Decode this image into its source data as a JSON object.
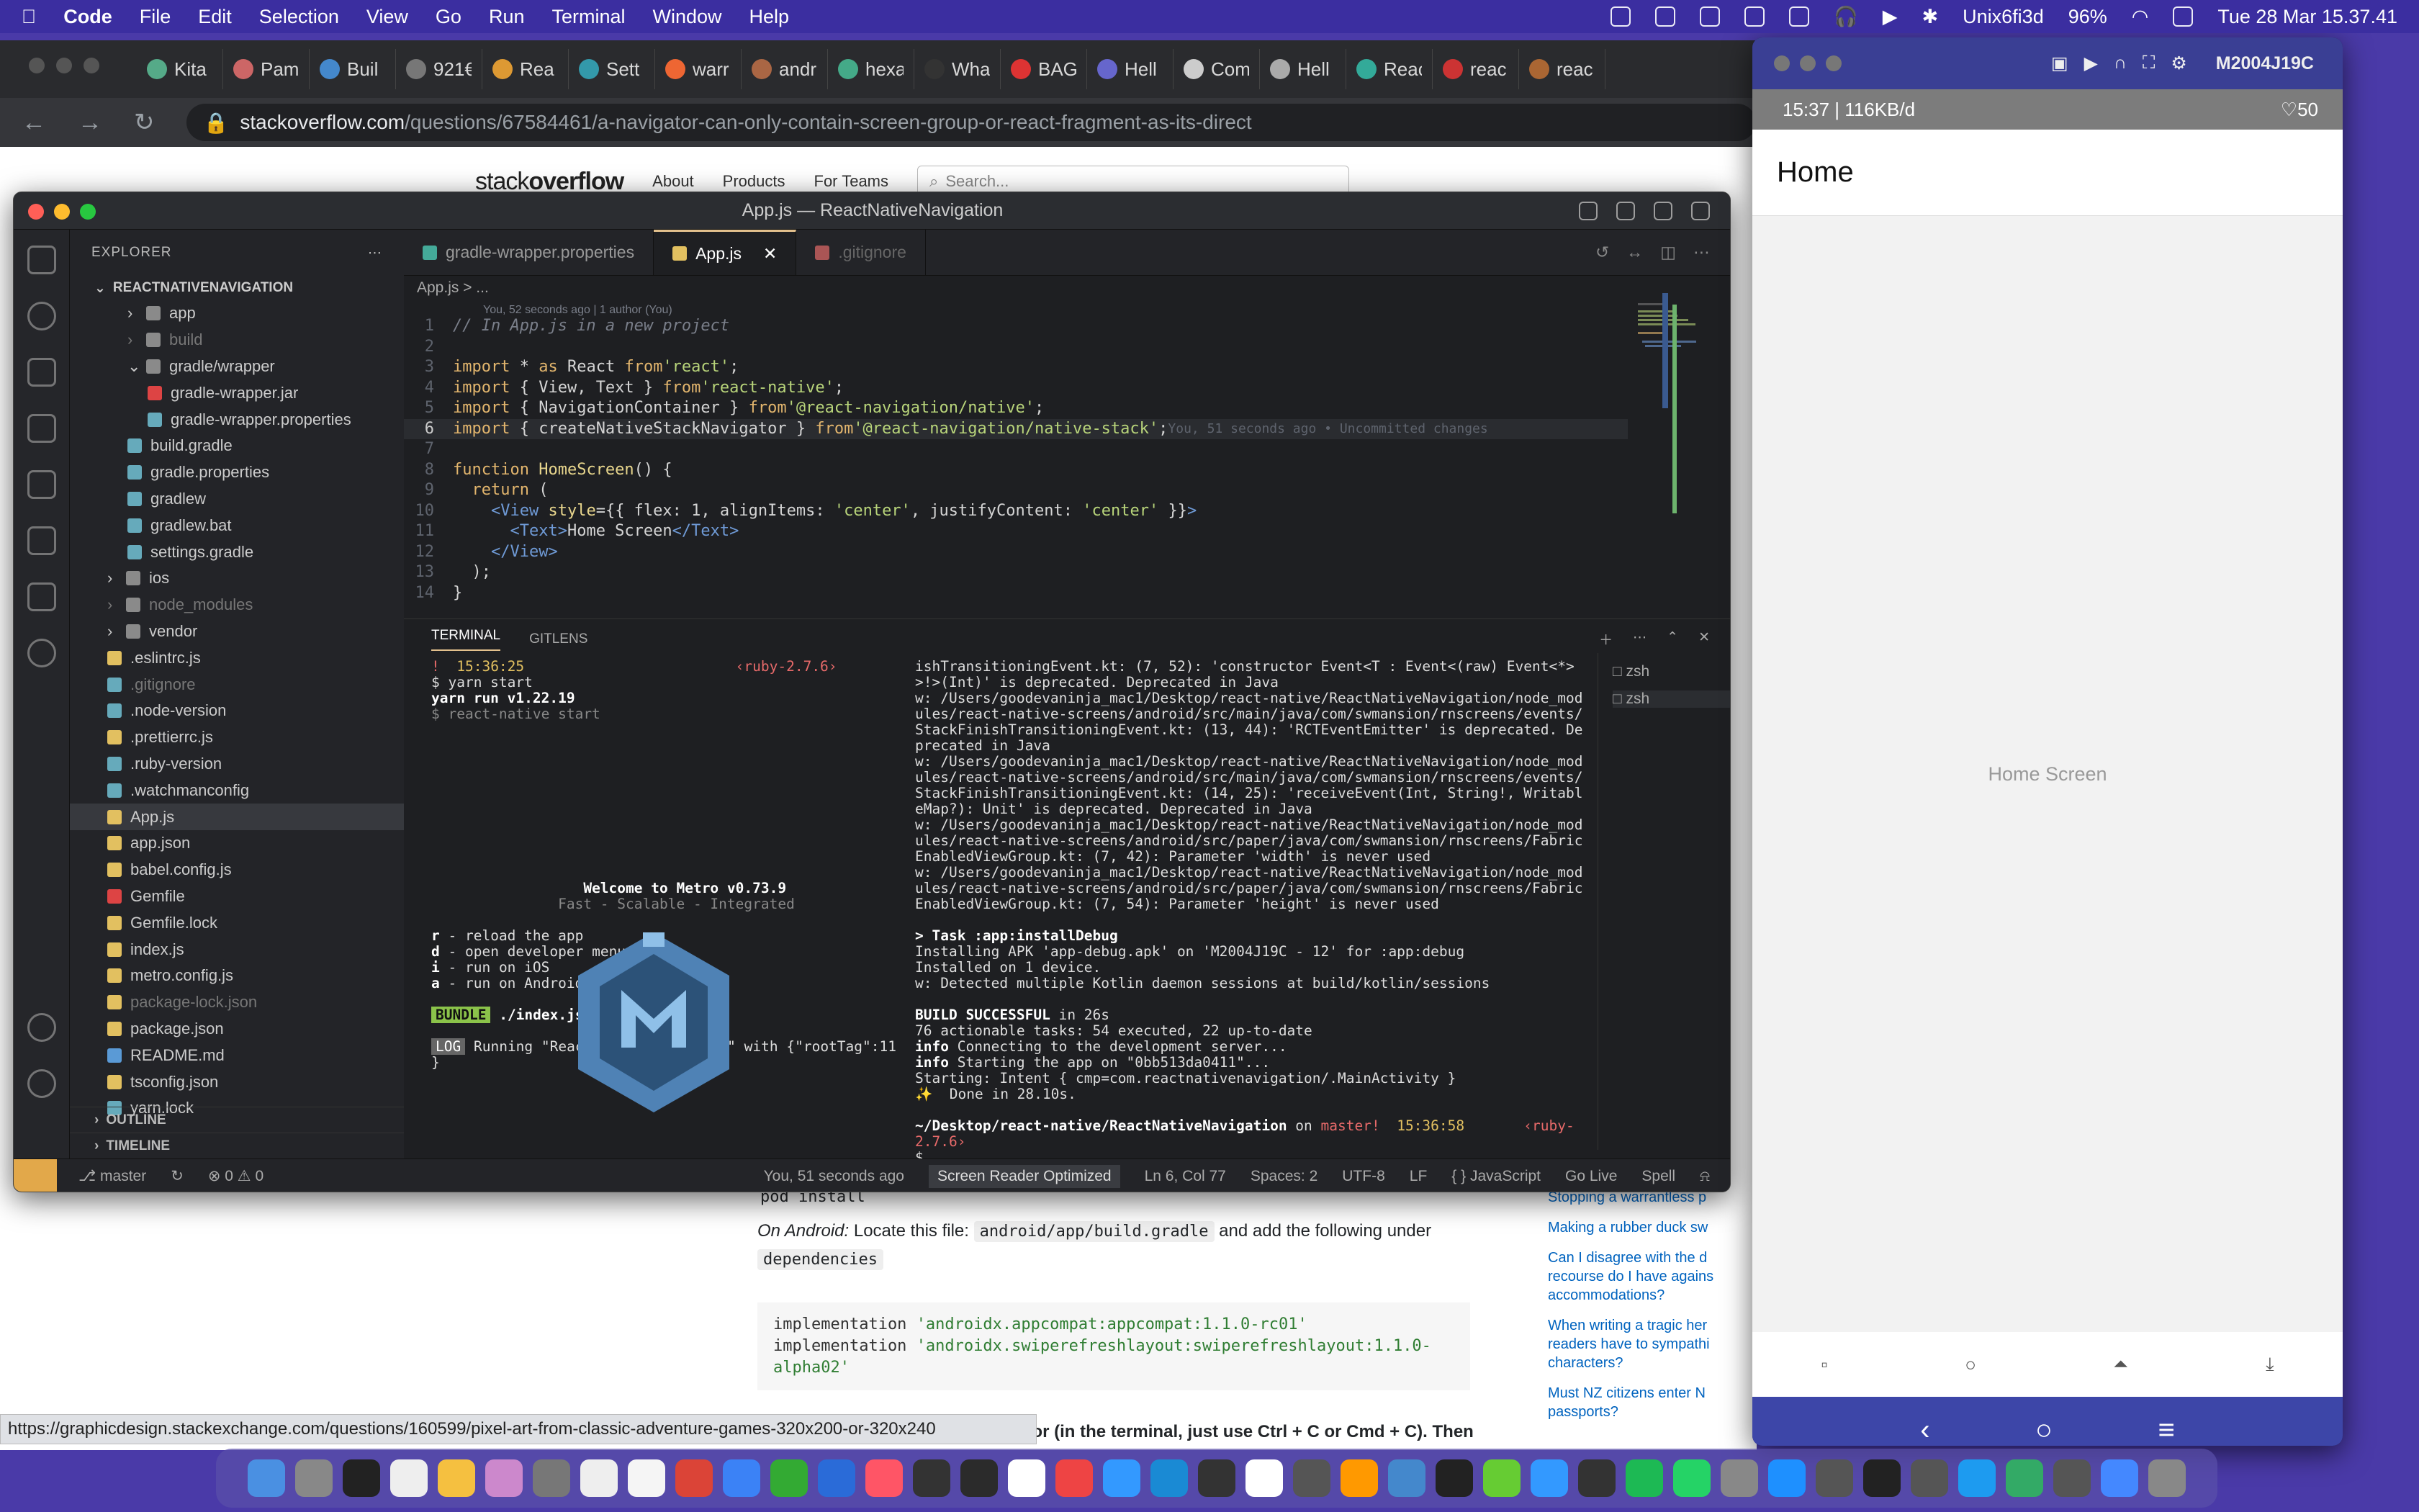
{
  "menubar": {
    "app": "Code",
    "items": [
      "File",
      "Edit",
      "Selection",
      "View",
      "Go",
      "Run",
      "Terminal",
      "Window",
      "Help"
    ],
    "user": "Unix6fi3d",
    "battery": "96%",
    "datetime": "Tue 28 Mar  15.37.41"
  },
  "browser": {
    "tabs": [
      "Kita",
      "Pam",
      "Buil",
      "921€",
      "Rea",
      "Sett",
      "warr",
      "andr",
      "hexa",
      "Wha",
      "BAG",
      "Hell",
      "Com",
      "Hell",
      "Reac",
      "reac",
      "reac"
    ],
    "url_host": "stackoverflow.com",
    "url_path": "/questions/67584461/a-navigator-can-only-contain-screen-group-or-react-fragment-as-its-direct",
    "status_url": "https://graphicdesign.stackexchange.com/questions/160599/pixel-art-from-classic-adventure-games-320x200-or-320x240"
  },
  "so": {
    "logo_a": "stack",
    "logo_b": "overflow",
    "nav": [
      "About",
      "Products",
      "For Teams"
    ],
    "search_placeholder": "Search...",
    "pod": "pod install",
    "android_prefix": "On Android:",
    "android_text": " Locate this file: ",
    "android_file": "android/app/build.gradle",
    "android_text2": " and add the following under ",
    "deps": "dependencies",
    "impl1_a": "implementation ",
    "impl1_b": "'androidx.appcompat:appcompat:1.1.0-rc01'",
    "impl2_a": "implementation ",
    "impl2_b": "'androidx.swiperefreshlayout:swiperefreshlayout:1.1.0-alpha02'",
    "step3": "3. Try to restart Metro and Emulator (in the terminal, just use Ctrl + C or Cmd + C). Then",
    "sidebar": [
      "Stopping a warrantless p",
      "Making a rubber duck sw",
      "Can I disagree with the d recourse do I have agains accommodations?",
      "When writing a tragic her readers have to sympathi characters?",
      "Must NZ citizens enter N passports?"
    ]
  },
  "vscode": {
    "title": "App.js — ReactNativeNavigation",
    "explorer_label": "EXPLORER",
    "project": "REACTNATIVENAVIGATION",
    "tree": [
      {
        "n": "app",
        "d": 1,
        "t": "dir"
      },
      {
        "n": "build",
        "d": 1,
        "t": "dir",
        "dim": true
      },
      {
        "n": "gradle/wrapper",
        "d": 1,
        "t": "open"
      },
      {
        "n": "gradle-wrapper.jar",
        "d": 2,
        "t": "jar"
      },
      {
        "n": "gradle-wrapper.properties",
        "d": 2,
        "t": "file"
      },
      {
        "n": "build.gradle",
        "d": 1,
        "t": "file"
      },
      {
        "n": "gradle.properties",
        "d": 1,
        "t": "file"
      },
      {
        "n": "gradlew",
        "d": 1,
        "t": "file"
      },
      {
        "n": "gradlew.bat",
        "d": 1,
        "t": "file"
      },
      {
        "n": "settings.gradle",
        "d": 1,
        "t": "file"
      },
      {
        "n": "ios",
        "d": 0,
        "t": "dir"
      },
      {
        "n": "node_modules",
        "d": 0,
        "t": "dir",
        "dim": true
      },
      {
        "n": "vendor",
        "d": 0,
        "t": "dir"
      },
      {
        "n": ".eslintrc.js",
        "d": 0,
        "t": "js"
      },
      {
        "n": ".gitignore",
        "d": 0,
        "t": "file",
        "dim": true
      },
      {
        "n": ".node-version",
        "d": 0,
        "t": "file"
      },
      {
        "n": ".prettierrc.js",
        "d": 0,
        "t": "js"
      },
      {
        "n": ".ruby-version",
        "d": 0,
        "t": "file"
      },
      {
        "n": ".watchmanconfig",
        "d": 0,
        "t": "file"
      },
      {
        "n": "App.js",
        "d": 0,
        "t": "js",
        "sel": true
      },
      {
        "n": "app.json",
        "d": 0,
        "t": "json"
      },
      {
        "n": "babel.config.js",
        "d": 0,
        "t": "js"
      },
      {
        "n": "Gemfile",
        "d": 0,
        "t": "gem"
      },
      {
        "n": "Gemfile.lock",
        "d": 0,
        "t": "lock"
      },
      {
        "n": "index.js",
        "d": 0,
        "t": "js"
      },
      {
        "n": "metro.config.js",
        "d": 0,
        "t": "js"
      },
      {
        "n": "package-lock.json",
        "d": 0,
        "t": "json",
        "dim": true
      },
      {
        "n": "package.json",
        "d": 0,
        "t": "json"
      },
      {
        "n": "README.md",
        "d": 0,
        "t": "md"
      },
      {
        "n": "tsconfig.json",
        "d": 0,
        "t": "json"
      },
      {
        "n": "yarn.lock",
        "d": 0,
        "t": "file"
      }
    ],
    "outline": "OUTLINE",
    "timeline": "TIMELINE",
    "tabs": [
      "gradle-wrapper.properties",
      "App.js",
      ".gitignore"
    ],
    "breadcrumb": "App.js > ...",
    "blame": "You, 52 seconds ago | 1 author (You)",
    "inline_blame": "You, 51 seconds ago • Uncommitted changes",
    "terminal_tab": "TERMINAL",
    "gitlens_tab": "GITLENS",
    "metro": {
      "bang": "!",
      "time": "15:36:25",
      "ruby": "‹ruby-2.7.6›",
      "cmd": "$ yarn start",
      "yarn": "yarn run v1.22.19",
      "rn": "$ react-native start",
      "welcome": "Welcome to Metro",
      "ver": "v0.73.9",
      "tag": "Fast - Scalable - Integrated",
      "keys": [
        [
          "r",
          "reload the app"
        ],
        [
          "d",
          "open developer menu"
        ],
        [
          "i",
          "run on iOS"
        ],
        [
          "a",
          "run on Android"
        ]
      ],
      "bundle": "BUNDLE",
      "bundle_file": "./index.js",
      "log": "LOG",
      "log_msg": "Running \"ReactNativeNavigation\" with {\"rootTag\":11",
      "close": "}"
    },
    "build": {
      "lines": [
        "ishTransitioningEvent.kt: (7, 52): 'constructor Event<T : Event<(raw) Event<*>>!>(Int)' is deprecated. Deprecated in Java",
        "w: /Users/goodevaninja_mac1/Desktop/react-native/ReactNativeNavigation/node_modules/react-native-screens/android/src/main/java/com/swmansion/rnscreens/events/StackFinishTransitioningEvent.kt: (13, 44): 'RCTEventEmitter' is deprecated. Deprecated in Java",
        "w: /Users/goodevaninja_mac1/Desktop/react-native/ReactNativeNavigation/node_modules/react-native-screens/android/src/main/java/com/swmansion/rnscreens/events/StackFinishTransitioningEvent.kt: (14, 25): 'receiveEvent(Int, String!, WritableMap?): Unit' is deprecated. Deprecated in Java",
        "w: /Users/goodevaninja_mac1/Desktop/react-native/ReactNativeNavigation/node_modules/react-native-screens/android/src/paper/java/com/swmansion/rnscreens/FabricEnabledViewGroup.kt: (7, 42): Parameter 'width' is never used",
        "w: /Users/goodevaninja_mac1/Desktop/react-native/ReactNativeNavigation/node_modules/react-native-screens/android/src/paper/java/com/swmansion/rnscreens/FabricEnabledViewGroup.kt: (7, 54): Parameter 'height' is never used"
      ],
      "task": "> Task :app:installDebug",
      "install1": "Installing APK 'app-debug.apk' on 'M2004J19C - 12' for :app:debug",
      "install2": "Installed on 1 device.",
      "kotlin": "w: Detected multiple Kotlin daemon sessions at build/kotlin/sessions",
      "success": "BUILD SUCCESSFUL",
      "success_t": " in 26s",
      "tasks": "76 actionable tasks: 54 executed, 22 up-to-date",
      "info": "info",
      "info1": " Connecting to the development server...",
      "info2": " Starting the app on \"0bb513da0411\"...",
      "starting": "Starting: Intent { cmp=com.reactnativenavigation/.MainActivity }",
      "done": "✨  Done in 28.10s.",
      "path": "~/Desktop/react-native/ReactNativeNavigation",
      "on": " on ",
      "branch": "master!",
      "ptime": "15:36:58",
      "pruby": "‹ruby-2.7.6›",
      "prompt": "$ _"
    },
    "shells": [
      "zsh",
      "zsh"
    ],
    "status": {
      "branch": "master",
      "errors": "⊗ 0 ⚠ 0",
      "blame": "You, 51 seconds ago",
      "sr": "Screen Reader Optimized",
      "pos": "Ln 6, Col 77",
      "spaces": "Spaces: 2",
      "enc": "UTF-8",
      "eol": "LF",
      "lang": "{ } JavaScript",
      "golive": "Go Live",
      "spell": "Spell"
    }
  },
  "emulator": {
    "title": "M2004J19C",
    "phone_status": "15:37 | 116KB/d",
    "battery": "50",
    "header": "Home",
    "body": "Home Screen"
  }
}
